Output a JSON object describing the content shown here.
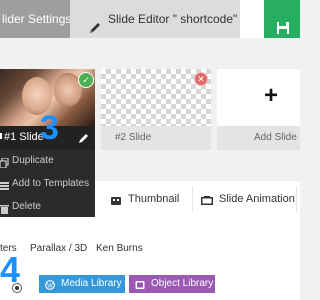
{
  "tabs": {
    "slider_settings": "lider Settings",
    "slide_editor": "Slide Editor \" shortcode\"",
    "save_icon": "floppy-disk-icon"
  },
  "slides": {
    "slide1": {
      "label": "#1 Slide",
      "annotation": "3"
    },
    "slide2": {
      "label": "#2 Slide"
    },
    "add": {
      "label": "Add Slide",
      "symbol": "+"
    }
  },
  "slide_menu": [
    {
      "label": "Duplicate",
      "icon": "duplicate-icon"
    },
    {
      "label": "Add to Templates",
      "icon": "templates-icon"
    },
    {
      "label": "Delete",
      "icon": "trash-icon"
    }
  ],
  "toolbar": {
    "thumbnail": "Thumbnail",
    "slide_animation": "Slide Animation"
  },
  "sub_tabs": [
    "ters",
    "Parallax / 3D",
    "Ken Burns"
  ],
  "annotation_4": "4",
  "buttons": {
    "media_library": "Media Library",
    "object_library": "Object Library"
  },
  "colors": {
    "accent_blue": "#1e90ff",
    "save_green": "#27ae60",
    "media_blue": "#3498db",
    "object_purple": "#9b59b6",
    "check_green": "#4caf50",
    "delete_red": "#e06a6a"
  }
}
